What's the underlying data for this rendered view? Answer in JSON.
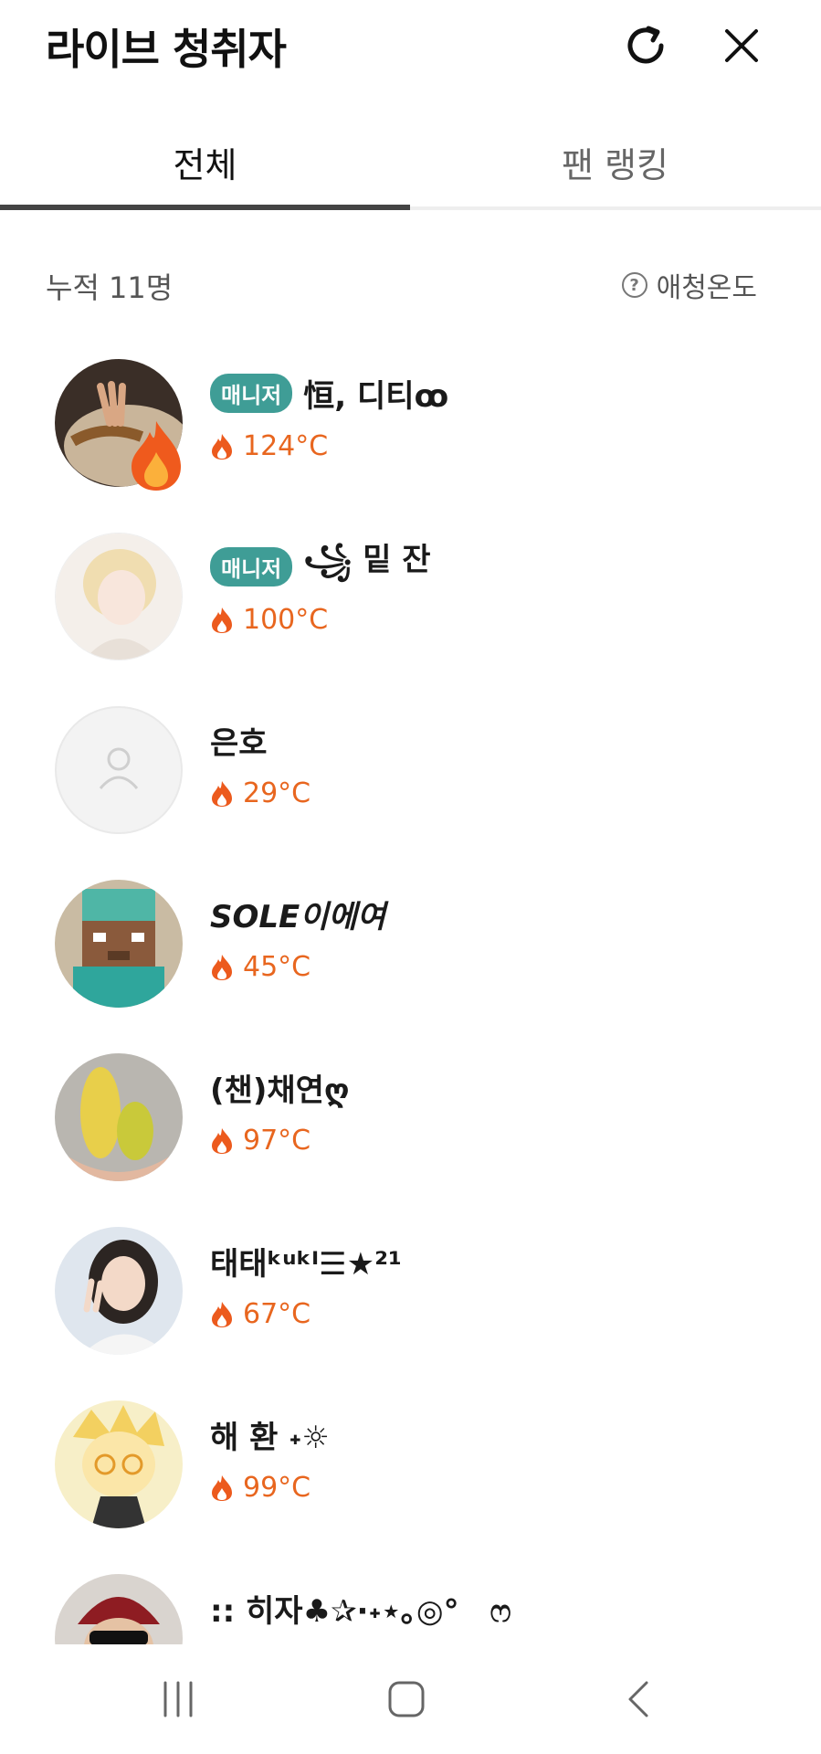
{
  "header": {
    "title": "라이브 청취자",
    "refresh_icon": "refresh-icon",
    "close_icon": "close-icon"
  },
  "tabs": [
    {
      "label": "전체",
      "active": true
    },
    {
      "label": "팬 랭킹",
      "active": false
    }
  ],
  "summary": {
    "count_label": "누적 11명",
    "affection_label": "애청온도",
    "help_icon": "help-circle-icon"
  },
  "listeners": [
    {
      "name": "恒, 디티ꝏ",
      "badge": "매니저",
      "temp": "124°C",
      "avatar": "photo-hand-food",
      "hot": true
    },
    {
      "name": "꧁ 밑 잔",
      "badge": "매니저",
      "temp": "100°C",
      "avatar": "anime-boy",
      "hot": false
    },
    {
      "name": "은호",
      "badge": "",
      "temp": "29°C",
      "avatar": "default-person",
      "hot": false
    },
    {
      "name": "SOLE이에여",
      "badge": "",
      "temp": "45°C",
      "avatar": "pixel-steve",
      "hot": false
    },
    {
      "name": "(챈)채연ღ",
      "badge": "",
      "temp": "97°C",
      "avatar": "crochet-corn",
      "hot": false
    },
    {
      "name": "태태ᵏᵘᵏᴵ☰★²¹",
      "badge": "",
      "temp": "67°C",
      "avatar": "girl-peace",
      "hot": false
    },
    {
      "name": "해 환 ˖☼",
      "badge": "",
      "temp": "99°C",
      "avatar": "anime-blonde",
      "hot": false
    },
    {
      "name": ":: 히자♣✰·˖⋆｡◎°　ෆ",
      "badge": "",
      "temp": "",
      "avatar": "man-red-beanie",
      "hot": false
    }
  ],
  "colors": {
    "badge": "#3f9d96",
    "temp": "#e8661f",
    "tab_active": "#444444"
  },
  "nav": {
    "recent_icon": "recent-apps-icon",
    "home_icon": "home-icon",
    "back_icon": "back-icon"
  }
}
